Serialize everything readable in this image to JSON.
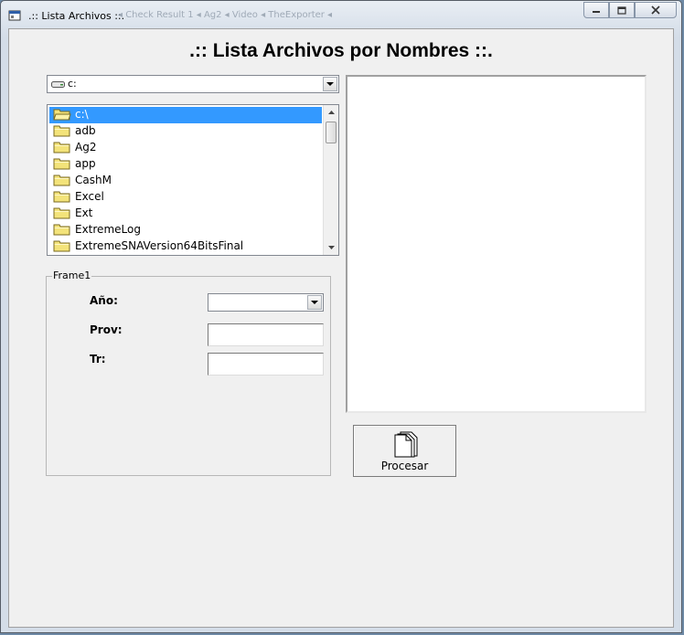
{
  "window": {
    "title": ".:: Lista Archivos ::.",
    "ghost_text": "◂  Check Result  1  ◂  Ag2  ◂  Video  ◂  TheExporter  ◂"
  },
  "heading": ".:: Lista Archivos por Nombres ::.",
  "drive": {
    "value": "c:"
  },
  "dirs": [
    {
      "label": "c:\\",
      "selected": true,
      "open": true
    },
    {
      "label": "adb"
    },
    {
      "label": "Ag2"
    },
    {
      "label": "app"
    },
    {
      "label": "CashM"
    },
    {
      "label": "Excel"
    },
    {
      "label": "Ext"
    },
    {
      "label": "ExtremeLog"
    },
    {
      "label": "ExtremeSNAVersion64BitsFinal"
    }
  ],
  "frame": {
    "caption": "Frame1",
    "year_label": "Año:",
    "year_value": "",
    "prov_label": "Prov:",
    "prov_value": "",
    "tr_label": "Tr:",
    "tr_value": ""
  },
  "process_button": {
    "label": "Procesar"
  },
  "colors": {
    "selection": "#3399ff",
    "client_bg": "#f0f0f0",
    "folder": "#f3e37a"
  }
}
